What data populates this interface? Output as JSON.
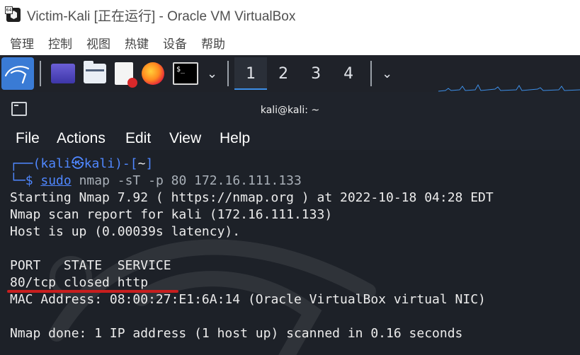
{
  "window": {
    "title": "Victim-Kali [正在运行] - Oracle VM VirtualBox",
    "app_icon": "virtualbox-icon"
  },
  "host_menu": [
    "管理",
    "控制",
    "视图",
    "热键",
    "设备",
    "帮助"
  ],
  "kali_panel": {
    "launchers": [
      "kali-menu-icon",
      "show-desktop-icon",
      "file-manager-icon",
      "text-editor-icon",
      "firefox-icon",
      "terminal-icon"
    ],
    "workspaces": [
      "1",
      "2",
      "3",
      "4"
    ],
    "active_workspace": "1"
  },
  "terminal": {
    "title": "kali@kali: ~",
    "menu": [
      "File",
      "Actions",
      "Edit",
      "View",
      "Help"
    ],
    "prompt": {
      "user": "kali",
      "at_symbol": "㉿",
      "host": "kali",
      "path": "~",
      "symbol": "$",
      "sudo": "sudo",
      "command": "nmap -sT -p 80 172.16.111.133"
    },
    "output": [
      "Starting Nmap 7.92 ( https://nmap.org ) at 2022-10-18 04:28 EDT",
      "Nmap scan report for kali (172.16.111.133)",
      "Host is up (0.00039s latency).",
      "",
      "PORT   STATE  SERVICE",
      "80/tcp closed http",
      "MAC Address: 08:00:27:E1:6A:14 (Oracle VirtualBox virtual NIC)",
      "",
      "Nmap done: 1 IP address (1 host up) scanned in 0.16 seconds"
    ]
  },
  "colors": {
    "prompt_blue": "#4f87ff",
    "terminal_bg": "#1d2128",
    "annotation_red": "#c81e1e",
    "panel_bg": "#1f2229"
  }
}
